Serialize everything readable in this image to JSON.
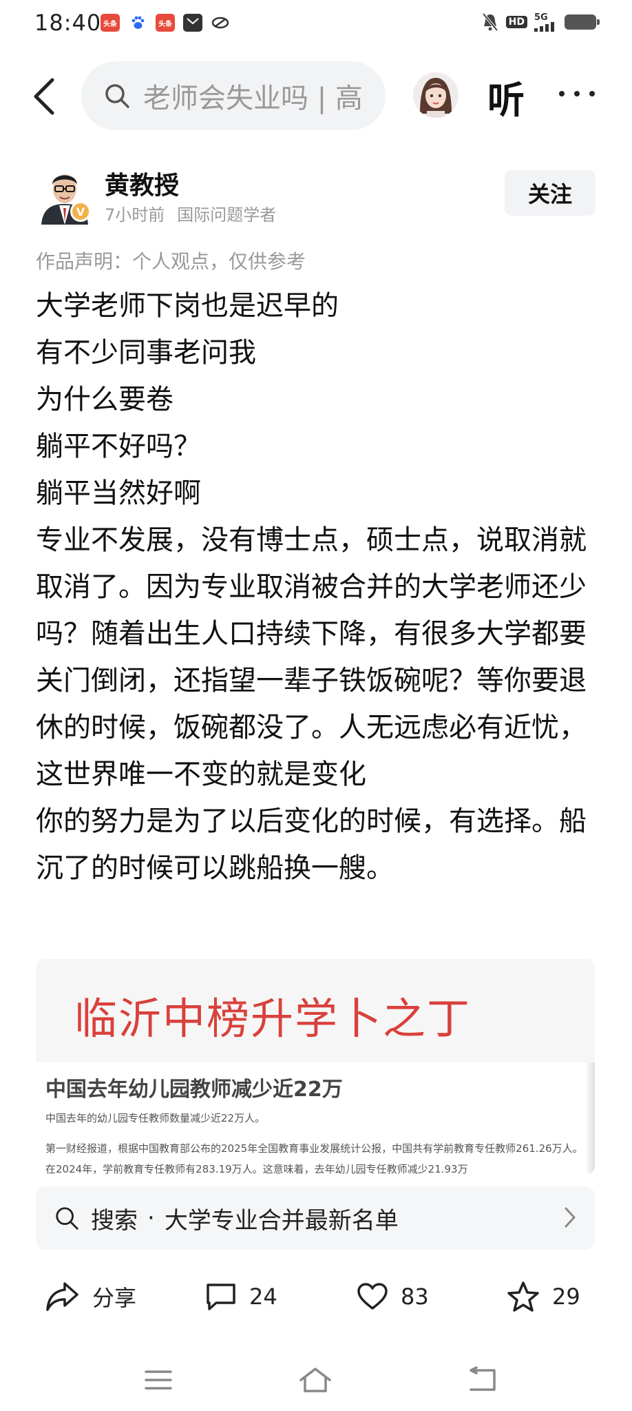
{
  "status_bar": {
    "time": "18:40",
    "app_icons": [
      {
        "name": "toutiao-icon",
        "label": "头条",
        "color": "#e64b3c"
      },
      {
        "name": "baidu-icon",
        "label": "",
        "color": "#2f6cf6"
      },
      {
        "name": "toutiao-icon-2",
        "label": "头条",
        "color": "#e64b3c"
      },
      {
        "name": "mail-icon",
        "label": "",
        "color": "#333333"
      },
      {
        "name": "link-icon",
        "label": "",
        "color": "#333333"
      }
    ],
    "hd": "HD",
    "network": "5G"
  },
  "nav": {
    "search_query": "老师会失业吗 | 高",
    "listen_label": "听"
  },
  "author": {
    "name": "黄教授",
    "time_ago": "7小时前",
    "title": "国际问题学者",
    "verified_mark": "V",
    "follow_label": "关注"
  },
  "statement": "作品声明：个人观点，仅供参考",
  "article": {
    "paragraphs": [
      "大学老师下岗也是迟早的",
      "有不少同事老问我",
      "为什么要卷",
      "躺平不好吗？",
      "躺平当然好啊",
      "专业不发展，没有博士点，硕士点，说取消就取消了。因为专业取消被合并的大学老师还少吗？随着出生人口持续下降，有很多大学都要关门倒闭，还指望一辈子铁饭碗呢？等你要退休的时候，饭碗都没了。人无远虑必有近忧，这世界唯一不变的就是变化",
      "你的努力是为了以后变化的时候，有选择。船沉了的时候可以跳船换一艘。"
    ]
  },
  "embed": {
    "red_text": "临沂中榜升学卜之丁",
    "headline": "中国去年幼儿园教师减少近22万",
    "sub": "中国去年的幼儿园专任教师数量减少近22万人。",
    "body": "第一财经报道，根据中国教育部公布的2025年全国教育事业发展统计公报，中国共有学前教育专任教师261.26万人。在2024年，学前教育专任教师有283.19万人。这意味着，去年幼儿园专任教师减少21.93万"
  },
  "suggestion": {
    "prefix": "搜索",
    "dot": "·",
    "text": "大学专业合并最新名单"
  },
  "actions": {
    "share": "分享",
    "comments": "24",
    "likes": "83",
    "favorites": "29"
  },
  "colors": {
    "accent_red": "#d9413c",
    "verified": "#f2b24a",
    "muted": "#999999"
  }
}
